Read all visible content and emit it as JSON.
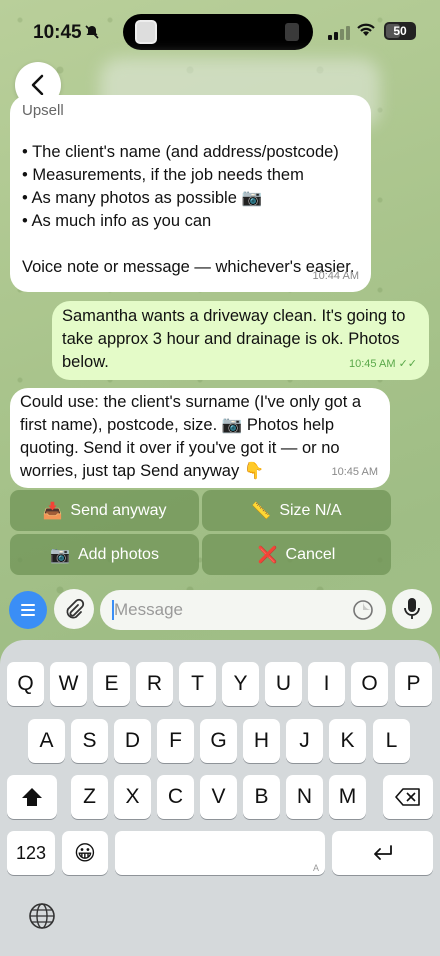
{
  "status_bar": {
    "time": "10:45",
    "battery": "50"
  },
  "messages": {
    "m1": {
      "top_text": "Upsell",
      "lines": [
        "• The client's name (and address/postcode)",
        "• Measurements, if the job needs them",
        "• As many photos as possible 📷",
        "• As much info as you can"
      ],
      "closing": "Voice note or message — whichever's easier.",
      "time": "10:44 AM"
    },
    "m2": {
      "text": "Samantha wants a driveway clean. It's going to take approx 3 hour and drainage is ok. Photos below.",
      "time": "10:45 AM"
    },
    "m3": {
      "text": "Could use: the client's surname (I've only got a first name), postcode, size. 📷 Photos help quoting. Send it over if you've got it — or no worries, just tap Send anyway 👇",
      "time": "10:45 AM"
    }
  },
  "inline_buttons": {
    "send_anyway": {
      "emoji": "📥",
      "label": "Send anyway"
    },
    "size_na": {
      "emoji": "📏",
      "label": "Size N/A"
    },
    "add_photos": {
      "emoji": "📷",
      "label": "Add photos"
    },
    "cancel": {
      "emoji": "❌",
      "label": "Cancel"
    }
  },
  "composer": {
    "placeholder": "Message"
  },
  "keyboard": {
    "row1": [
      "Q",
      "W",
      "E",
      "R",
      "T",
      "Y",
      "U",
      "I",
      "O",
      "P"
    ],
    "row2": [
      "A",
      "S",
      "D",
      "F",
      "G",
      "H",
      "J",
      "K",
      "L"
    ],
    "row3": [
      "Z",
      "X",
      "C",
      "V",
      "B",
      "N",
      "M"
    ],
    "numbers_key": "123",
    "emoji_key": "😀",
    "space_hint": "A"
  },
  "colors": {
    "accent": "#3a8ef6",
    "outgoing_bubble": "#e4fbc8",
    "inline_button": "#6e9155"
  }
}
